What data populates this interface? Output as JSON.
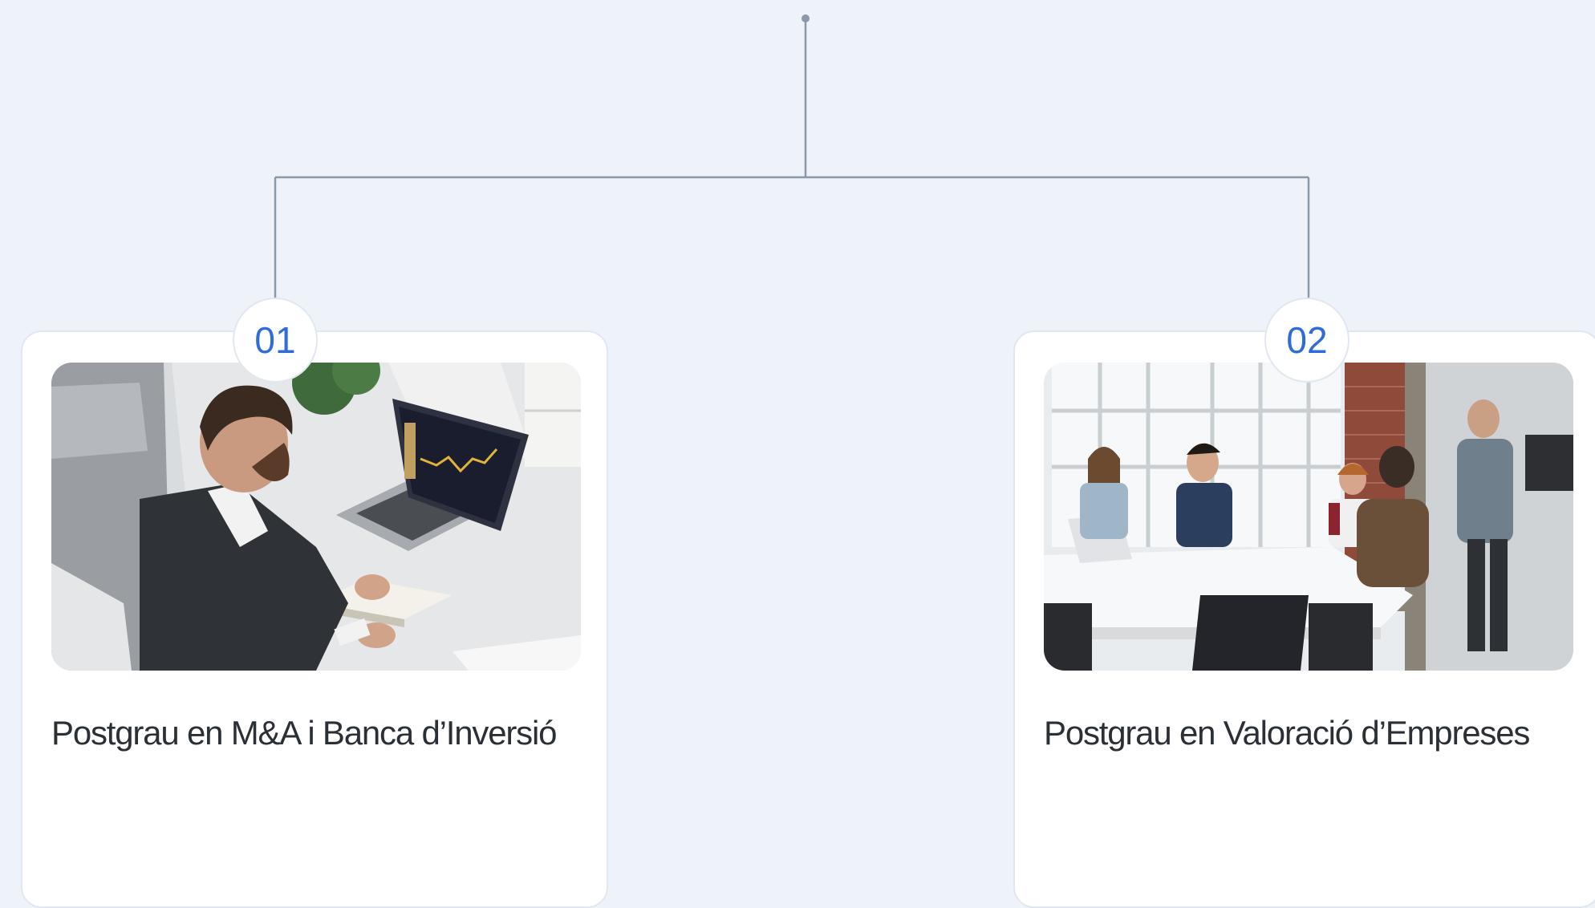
{
  "programs": [
    {
      "number": "01",
      "title": "Postgrau en M&A i Banca d’Inversió",
      "image": "businessman-laptop-stock-chart-photo"
    },
    {
      "number": "02",
      "title": "Postgrau en Valoració d’Empreses",
      "image": "team-meeting-office-photo"
    }
  ],
  "colors": {
    "background": "#eef2f9",
    "connector": "#8b98a8",
    "badge_text": "#2f6bdb",
    "title_text": "#2b2f36",
    "card_border": "#e1e7f0"
  }
}
